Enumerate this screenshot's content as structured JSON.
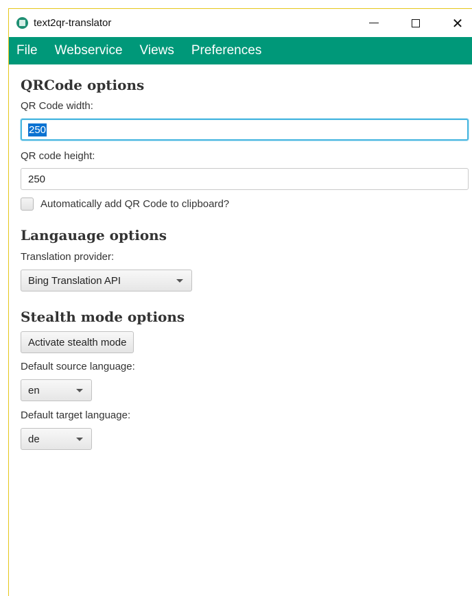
{
  "window": {
    "title": "text2qr-translator",
    "minimize_glyph": "minimize-icon",
    "maximize_glyph": "maximize-icon",
    "close_glyph": "✕"
  },
  "menubar": {
    "color": "#009879",
    "items": [
      "File",
      "Webservice",
      "Views",
      "Preferences"
    ]
  },
  "qrcode": {
    "heading": "QRCode options",
    "width_label": "QR Code width:",
    "width_value": "250",
    "height_label": "QR code height:",
    "height_value": "250",
    "clipboard_label": "Automatically add QR Code to clipboard?",
    "clipboard_checked": false
  },
  "language": {
    "heading": "Langauage  options",
    "provider_label": "Translation provider:",
    "provider_selected": "Bing Translation API"
  },
  "stealth": {
    "heading": "Stealth mode options",
    "activate_button": "Activate stealth mode",
    "source_label": "Default source language:",
    "source_selected": "en",
    "target_label": "Default target language:",
    "target_selected": "de"
  },
  "colors": {
    "accent": "#009879",
    "focus_border": "#48b6e0",
    "selection": "#0b72d1"
  }
}
